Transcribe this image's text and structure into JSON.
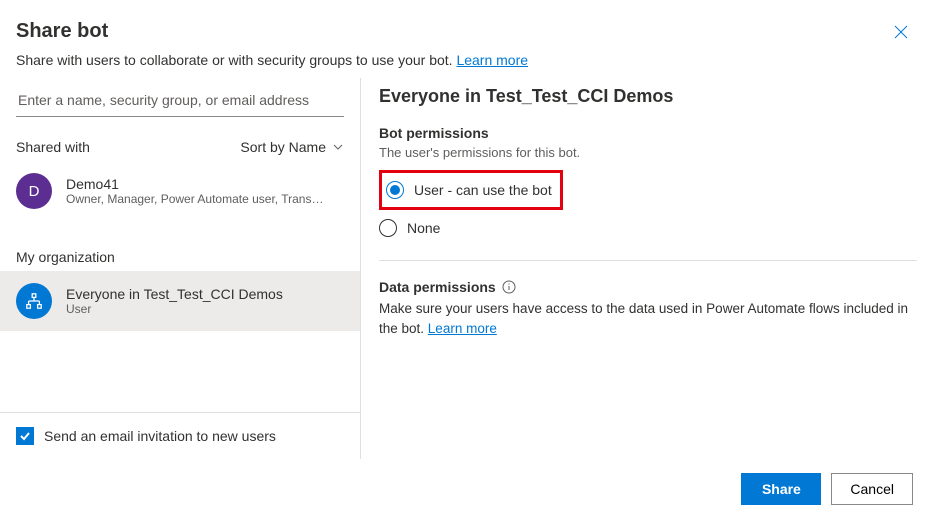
{
  "dialog": {
    "title": "Share bot",
    "description": "Share with users to collaborate or with security groups to use your bot. ",
    "learn_more": "Learn more"
  },
  "search": {
    "placeholder": "Enter a name, security group, or email address"
  },
  "shared": {
    "label": "Shared with",
    "sort_label": "Sort by Name",
    "items": [
      {
        "name": "Demo41",
        "sub": "Owner, Manager, Power Automate user, Transc...",
        "letter": "D"
      }
    ],
    "org_label": "My organization",
    "org_items": [
      {
        "name": "Everyone in Test_Test_CCI Demos",
        "sub": "User"
      }
    ]
  },
  "send_email": {
    "label": "Send an email invitation to new users",
    "checked": true
  },
  "details": {
    "title": "Everyone in Test_Test_CCI Demos",
    "bot_perm": {
      "heading": "Bot permissions",
      "sub": "The user's permissions for this bot."
    },
    "options": {
      "user": "User - can use the bot",
      "none": "None",
      "selected": "user"
    },
    "data_perm": {
      "heading": "Data permissions",
      "text": "Make sure your users have access to the data used in Power Automate flows included in the bot. ",
      "learn_more": "Learn more"
    }
  },
  "footer": {
    "share": "Share",
    "cancel": "Cancel"
  }
}
